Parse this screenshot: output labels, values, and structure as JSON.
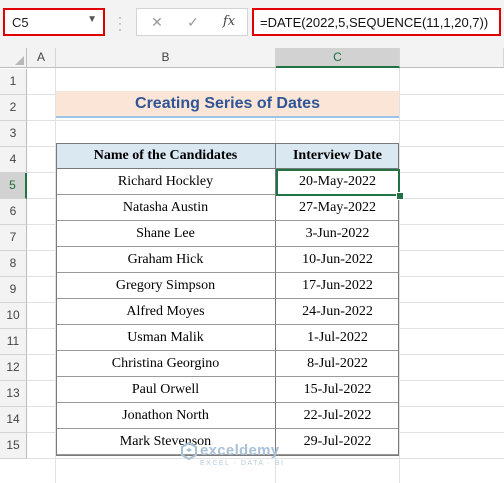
{
  "formula_bar": {
    "name_box": "C5",
    "cancel_icon": "✕",
    "enter_icon": "✓",
    "fx_label": "fx",
    "formula": "=DATE(2022,5,SEQUENCE(11,1,20,7))"
  },
  "columns": [
    "A",
    "B",
    "C"
  ],
  "rows": [
    "1",
    "2",
    "3",
    "4",
    "5",
    "6",
    "7",
    "8",
    "9",
    "10",
    "11",
    "12",
    "13",
    "14",
    "15"
  ],
  "selected": {
    "column": "C",
    "row": "5"
  },
  "sheet": {
    "title": "Creating Series of Dates",
    "headers": [
      "Name of the Candidates",
      "Interview Date"
    ],
    "table": [
      {
        "name": "Richard Hockley",
        "date": "20-May-2022"
      },
      {
        "name": "Natasha Austin",
        "date": "27-May-2022"
      },
      {
        "name": "Shane Lee",
        "date": "3-Jun-2022"
      },
      {
        "name": "Graham Hick",
        "date": "10-Jun-2022"
      },
      {
        "name": "Gregory Simpson",
        "date": "17-Jun-2022"
      },
      {
        "name": "Alfred Moyes",
        "date": "24-Jun-2022"
      },
      {
        "name": "Usman Malik",
        "date": "1-Jul-2022"
      },
      {
        "name": "Christina Georgino",
        "date": "8-Jul-2022"
      },
      {
        "name": "Paul Orwell",
        "date": "15-Jul-2022"
      },
      {
        "name": "Jonathon North",
        "date": "22-Jul-2022"
      },
      {
        "name": "Mark Stevenson",
        "date": "29-Jul-2022"
      }
    ]
  },
  "watermark": {
    "name": "exceldemy",
    "tagline": "EXCEL · DATA · BI"
  },
  "colors": {
    "selection": "#217346",
    "highlight_border": "#e00000",
    "title_fill": "#fbe5d6",
    "header_fill": "#dae8f2",
    "title_text": "#2f5597"
  }
}
